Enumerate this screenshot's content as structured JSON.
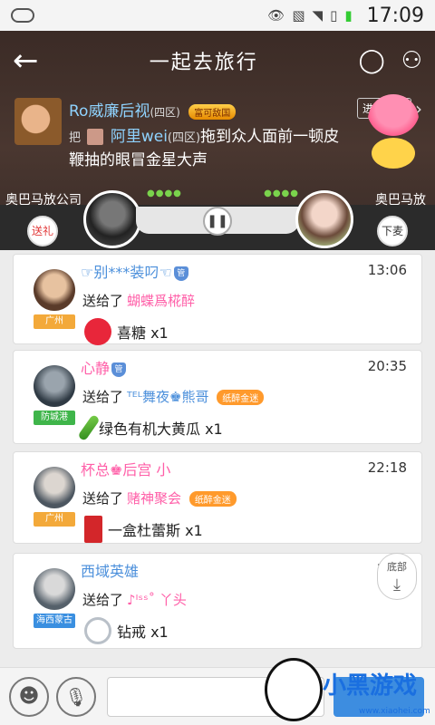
{
  "status_bar": {
    "time": "17:09"
  },
  "header": {
    "title": "一起去旅行",
    "back_icon": "back-arrow-icon",
    "chat_icon": "speech-bubble-icon",
    "members_icon": "people-icon"
  },
  "broadcast": {
    "user_name": "Ro威廉后视",
    "region": "(四区)",
    "user_badge": "富可敌国",
    "enter_all": "进入全国",
    "prefix": "把",
    "victim_name": "阿里wei",
    "victim_region": "(四区)",
    "action_text": "拖到众人面前一顿皮",
    "line2": "鞭抽的眼冒金星大声"
  },
  "player": {
    "left_name": "奥巴马放公司",
    "right_name": "奥巴马放",
    "gift_button": "送礼",
    "down_button": "下麦"
  },
  "messages": [
    {
      "name": "☞别***装叼☜",
      "badge": "管",
      "time": "13:06",
      "location": "广州",
      "location_color": "#f3a93a",
      "sent_label": "送给了",
      "target": "蝴蝶爲椛醉",
      "target_tag": "",
      "gift": "喜糖 x1",
      "gift_icon": "candy-icon",
      "gift_color": "#e8263a"
    },
    {
      "name": "心静",
      "badge": "管",
      "time": "20:35",
      "location": "防城港",
      "location_color": "#3fb54a",
      "sent_label": "送给了",
      "target": "ᵀᴱᴸ舞夜♚熊哥",
      "target_tag": "纸醉金迷",
      "gift": "绿色有机大黄瓜 x1",
      "gift_icon": "cucumber-icon",
      "gift_color": "#4caa2a"
    },
    {
      "name": "杯总♚后宫 小",
      "badge": "",
      "time": "22:18",
      "location": "广州",
      "location_color": "#f3a93a",
      "sent_label": "送给了",
      "target": "赌神聚会",
      "target_tag": "纸醉金迷",
      "gift": "一盒杜蕾斯 x1",
      "gift_icon": "box-icon",
      "gift_color": "#d3262a"
    },
    {
      "name": "西域英雄",
      "badge": "",
      "time": "1",
      "location": "海西蒙古",
      "location_color": "#3a8fe0",
      "sent_label": "送给了",
      "target": "♪ᴵˢˢ˚ 丫头",
      "target_tag": "",
      "gift": "钻戒 x1",
      "gift_icon": "ring-icon",
      "gift_color": "#cfd6de"
    }
  ],
  "bottom_button": "底部",
  "watermark": {
    "text": "小黑游戏",
    "url": "www.xiaohei.com"
  }
}
